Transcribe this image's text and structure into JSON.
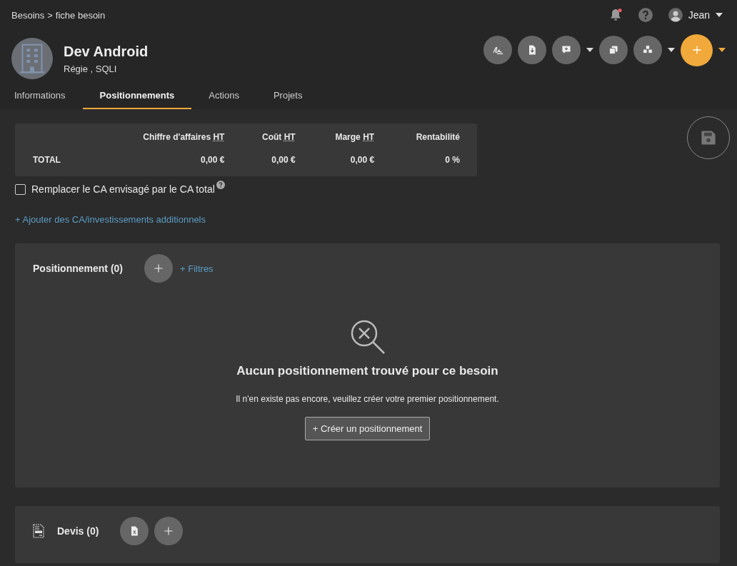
{
  "breadcrumb": {
    "parent": "Besoins",
    "separator": ">",
    "current": "fiche besoin"
  },
  "topbar": {
    "notifications_unread": true,
    "user": "Jean"
  },
  "header": {
    "title": "Dev Android",
    "subtitle": "Régie , SQLI"
  },
  "tabs": [
    {
      "label": "Informations",
      "selected": false
    },
    {
      "label": "Positionnements",
      "selected": true
    },
    {
      "label": "Actions",
      "selected": false
    },
    {
      "label": "Projets",
      "selected": false
    }
  ],
  "totals": {
    "columns": [
      {
        "label": "Chiffre d'affaires",
        "abbr": "HT"
      },
      {
        "label": "Coût",
        "abbr": "HT"
      },
      {
        "label": "Marge",
        "abbr": "HT"
      },
      {
        "label": "Rentabilité"
      }
    ],
    "row": {
      "label": "TOTAL",
      "values": [
        "0,00 €",
        "0,00 €",
        "0,00 €",
        "0 %"
      ]
    }
  },
  "replace_checkbox": {
    "label": "Remplacer le CA envisagé par le CA total",
    "checked": false
  },
  "add_link": "+ Ajouter des CA/investissements additionnels",
  "positionnement": {
    "title": "Positionnement (0)",
    "filters": "+ Filtres",
    "empty_title": "Aucun positionnement trouvé pour ce besoin",
    "empty_text": "Il n'en existe pas encore, veuillez créer votre premier positionnement.",
    "create_button": "+ Créer un positionnement"
  },
  "devis": {
    "title": "Devis (0)"
  }
}
